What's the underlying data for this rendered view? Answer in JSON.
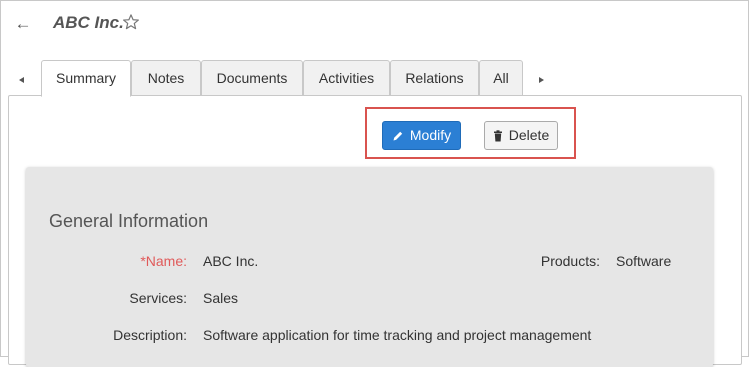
{
  "header": {
    "title": "ABC Inc."
  },
  "tabs": [
    {
      "label": "Summary",
      "active": true
    },
    {
      "label": "Notes",
      "active": false
    },
    {
      "label": "Documents",
      "active": false
    },
    {
      "label": "Activities",
      "active": false
    },
    {
      "label": "Relations",
      "active": false
    },
    {
      "label": "All",
      "active": false
    }
  ],
  "actions": {
    "modify_label": "Modify",
    "delete_label": "Delete"
  },
  "general_information": {
    "title": "General Information",
    "name_label": "*Name:",
    "name_value": "ABC Inc.",
    "products_label": "Products:",
    "products_value": "Software",
    "services_label": "Services:",
    "services_value": "Sales",
    "description_label": "Description:",
    "description_value": "Software application for time tracking and project management"
  },
  "icons": {
    "back": "arrow-left-icon",
    "favorite": "star-outline-icon",
    "modify": "pencil-icon",
    "delete": "trash-icon",
    "tab_scroll_left": "triangle-left-icon",
    "tab_scroll_right": "triangle-right-icon"
  },
  "colors": {
    "primary_button": "#2b7fd4",
    "highlight_border": "#d9534f",
    "required_label": "#e05a5a",
    "card_background": "#e6e6e6"
  }
}
